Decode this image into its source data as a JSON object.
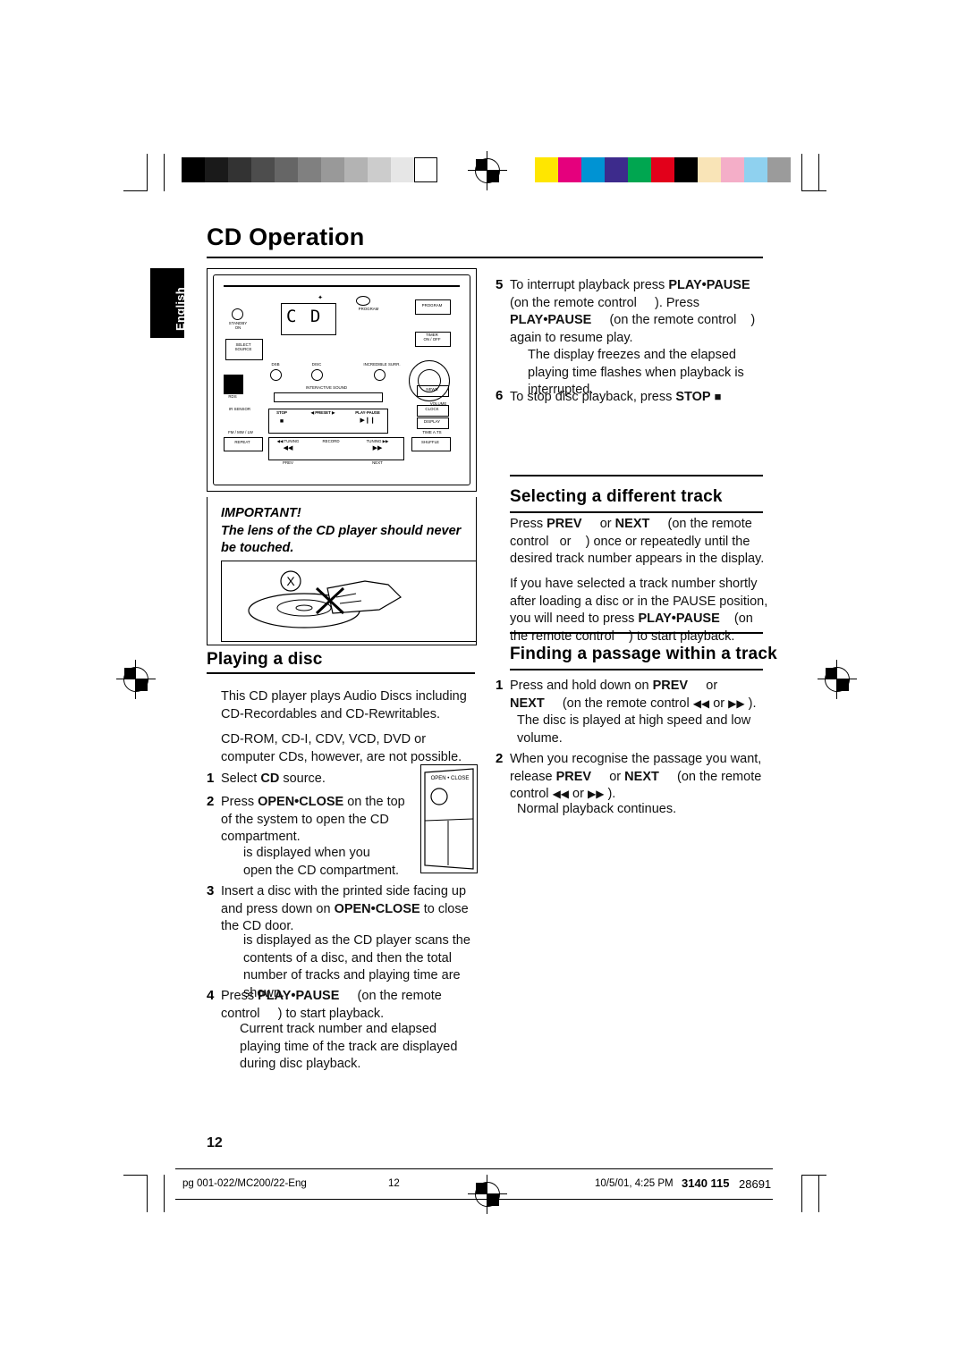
{
  "page": {
    "title": "CD Operation",
    "side_tab": "English",
    "page_number": "12"
  },
  "footer": {
    "file": "pg 001-022/MC200/22-Eng",
    "page": "12",
    "date": "10/5/01, 4:25 PM",
    "code_bold": "3140 115",
    "code": "28691"
  },
  "unit": {
    "standby": "STANDBY\nON",
    "brand": "",
    "program": "PROGRAM",
    "program_btn": "PROGRAM",
    "timer": "TIMER\nON / OFF",
    "select_source": "SELECT\nSOURCE",
    "dsb": "DSB",
    "disc": "DISC",
    "interactive_sound": "INTERACTIVE SOUND",
    "surround": "INCREDIBLE SURR.",
    "volume": "VOLUME",
    "rds": "RDS",
    "ir_sensor": "IR SENSOR",
    "clock": "CLOCK",
    "display": "DISPLAY",
    "news": "NEWS",
    "shuffle": "SHUFFLE",
    "repeat": "REPEAT",
    "fmw": "FM / MW / LW",
    "time_date": "TIME  A.TS",
    "stop": "STOP",
    "preset": "PRESET",
    "playpause": "PLAY·PAUSE",
    "tuning_left": "TUNING",
    "record": "RECORD",
    "tuning_right": "TUNING",
    "prev": "PREV",
    "next": "NEXT",
    "lcd": "C D"
  },
  "important": {
    "heading": "IMPORTANT!",
    "text": "The lens of the CD player should never be touched."
  },
  "openclose_fig": {
    "label": "OPEN • CLOSE"
  },
  "sections": {
    "playing_a_disc": {
      "heading": "Playing a disc",
      "paragraphs": [
        "This CD player plays Audio Discs including CD-Recordables and CD-Rewritables.",
        "CD-ROM, CD-I, CDV, VCD, DVD or computer CDs, however, are not possible."
      ],
      "steps": [
        {
          "n": "1",
          "lines": [
            "Select CD source."
          ]
        },
        {
          "n": "2",
          "lines": [
            "Press OPEN•CLOSE on the top",
            "of the system to open the CD",
            "compartment.",
            "is displayed when you",
            "open the CD compartment."
          ]
        },
        {
          "n": "3",
          "lines": [
            "Insert a disc with the printed side facing up and",
            "press down on OPEN•CLOSE to close the",
            "CD door.",
            "is displayed as the CD player scans the",
            "contents of a disc, and then the total number of",
            "tracks and playing time are shown."
          ]
        },
        {
          "n": "4",
          "lines": [
            "Press PLAY•PAUSE         (on the remote",
            "control      ) to start playback.",
            "Current track number and elapsed playing",
            "time of the track are displayed during disc",
            "playback."
          ]
        }
      ]
    },
    "right_top_steps": [
      {
        "n": "5",
        "lines": [
          "To interrupt playback press PLAY•PAUSE",
          "(on the remote control          ). Press",
          "PLAY•PAUSE          (on the remote control        )",
          "again to resume play.",
          "The display freezes and the elapsed playing",
          "time flashes when playback is interrupted."
        ]
      },
      {
        "n": "6",
        "lines": [
          "To stop disc playback, press STOP  9"
        ]
      }
    ],
    "selecting_track": {
      "heading": "Selecting a different track",
      "paragraphs": [
        "Press PREV        or NEXT        (on the remote control     or      ) once or repeatedly until the desired track number appears in the display.",
        "If you have selected a track number shortly after loading a disc or in the PAUSE position, you will need to press PLAY•PAUSE        (on the remote control      ) to start playback."
      ]
    },
    "finding_passage": {
      "heading": "Finding a passage within a track",
      "steps": [
        {
          "n": "1",
          "lines": [
            "Press and hold down on PREV         or",
            "NEXT         (on the remote control  6 or  5 ).",
            "The disc is played at high speed and low",
            "volume."
          ]
        },
        {
          "n": "2",
          "lines": [
            "When you recognise the passage you want,",
            "release PREV         or NEXT          (on the",
            "remote control  6 or  5 ).",
            "Normal playback continues."
          ]
        }
      ]
    }
  },
  "colorbar": {
    "grays": [
      "#000000",
      "#1a1a1a",
      "#333333",
      "#4d4d4d",
      "#666666",
      "#808080",
      "#999999",
      "#b3b3b3",
      "#cccccc",
      "#e6e6e6",
      "#ffffff"
    ],
    "colors": [
      "#ffe600",
      "#e5007d",
      "#0093d3",
      "#3d2b8c",
      "#00a650",
      "#e2001a",
      "#000000",
      "#f9e4b7",
      "#f4aec8",
      "#8fd1ef",
      "#9b9b9b"
    ]
  }
}
